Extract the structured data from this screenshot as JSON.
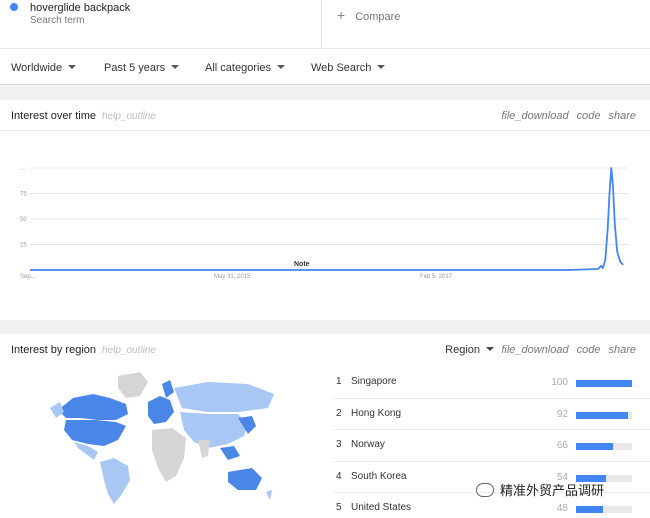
{
  "search": {
    "term": "hoverglide backpack",
    "term_type": "Search term",
    "term_color": "#4285f4",
    "compare_label": "Compare"
  },
  "filters": {
    "location": "Worldwide",
    "period": "Past 5 years",
    "category": "All categories",
    "property": "Web Search"
  },
  "interest_over_time": {
    "title": "Interest over time",
    "help": "help_outline",
    "actions": {
      "download": "file_download",
      "code": "code",
      "share": "share"
    },
    "note_label": "Note"
  },
  "chart_data": {
    "type": "line",
    "y_ticks": [
      "...",
      "75",
      "50",
      "25"
    ],
    "x_ticks": [
      "Sep...",
      "May 31, 2015",
      "Feb 5, 2017"
    ],
    "ylim": [
      0,
      100
    ],
    "grid": true,
    "series": [
      {
        "color": "#4285f4",
        "points": [
          [
            0,
            0
          ],
          [
            0.5,
            0
          ],
          [
            0.8,
            0
          ],
          [
            0.9,
            0
          ],
          [
            0.95,
            1
          ],
          [
            0.955,
            4
          ],
          [
            0.958,
            2
          ],
          [
            0.962,
            10
          ],
          [
            0.966,
            40
          ],
          [
            0.969,
            75
          ],
          [
            0.972,
            100
          ],
          [
            0.975,
            82
          ],
          [
            0.978,
            45
          ],
          [
            0.982,
            18
          ],
          [
            0.987,
            8
          ],
          [
            0.992,
            5
          ]
        ]
      }
    ]
  },
  "interest_by_region": {
    "title": "Interest by region",
    "help": "help_outline",
    "resolution": "Region",
    "actions": {
      "download": "file_download",
      "code": "code",
      "share": "share"
    },
    "rows": [
      {
        "rank": "1",
        "name": "Singapore",
        "value": 100
      },
      {
        "rank": "2",
        "name": "Hong Kong",
        "value": 92
      },
      {
        "rank": "3",
        "name": "Norway",
        "value": 66
      },
      {
        "rank": "4",
        "name": "South Korea",
        "value": 54
      },
      {
        "rank": "5",
        "name": "United States",
        "value": 48
      }
    ]
  },
  "watermark": {
    "text": "精准外贸产品调研",
    "icon": "wechat-icon"
  },
  "colors": {
    "accent": "#4285f4",
    "map_strong": "#4a86e8",
    "map_light": "#a8c7f5",
    "map_none": "#d5d5d5"
  }
}
